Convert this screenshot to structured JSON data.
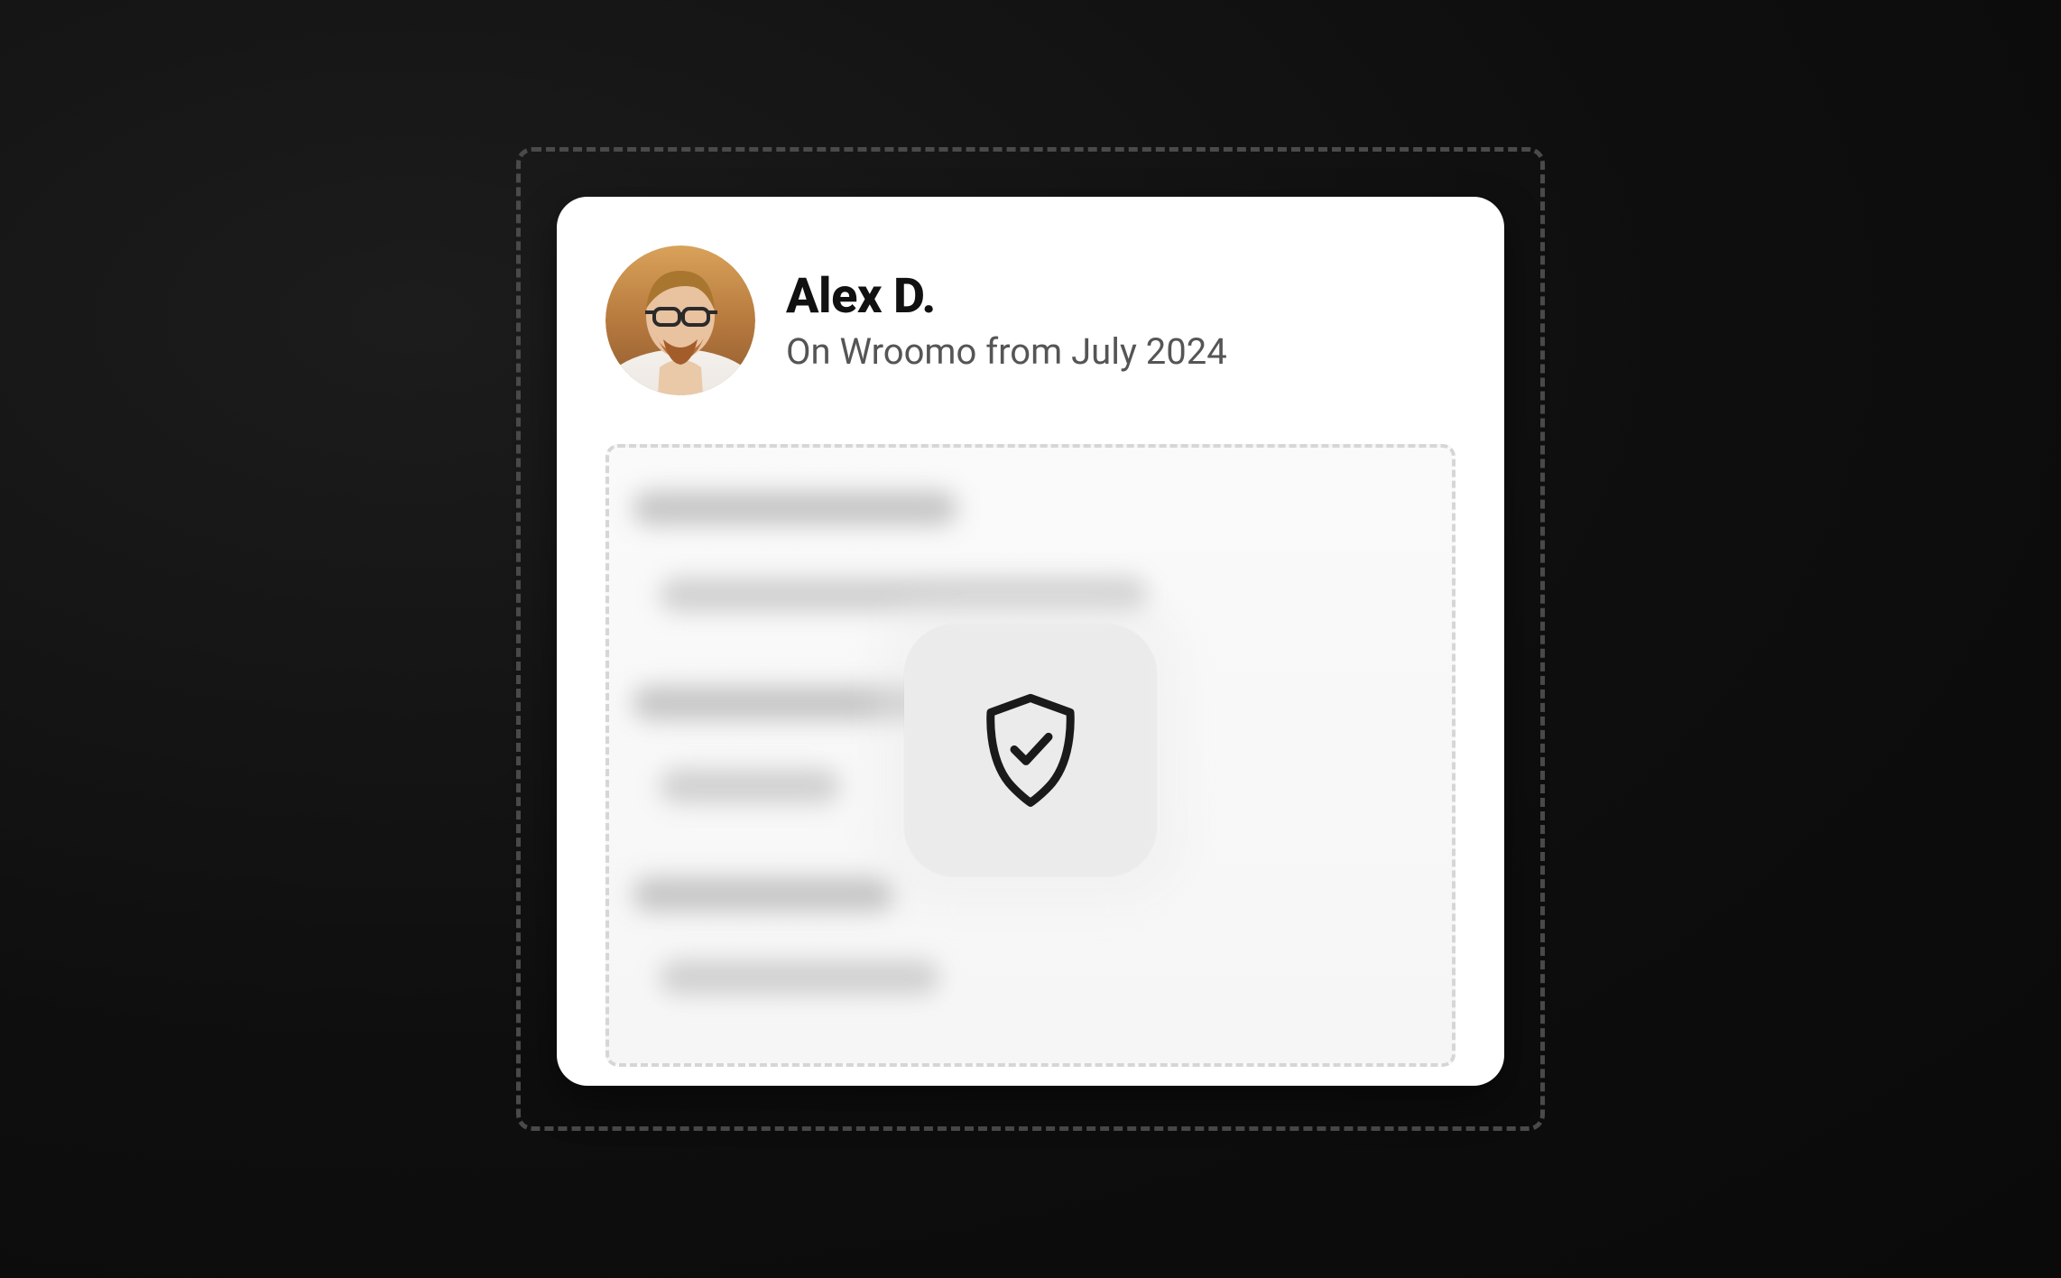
{
  "profile": {
    "name": "Alex D.",
    "subtitle": "On Wroomo from July 2024"
  }
}
